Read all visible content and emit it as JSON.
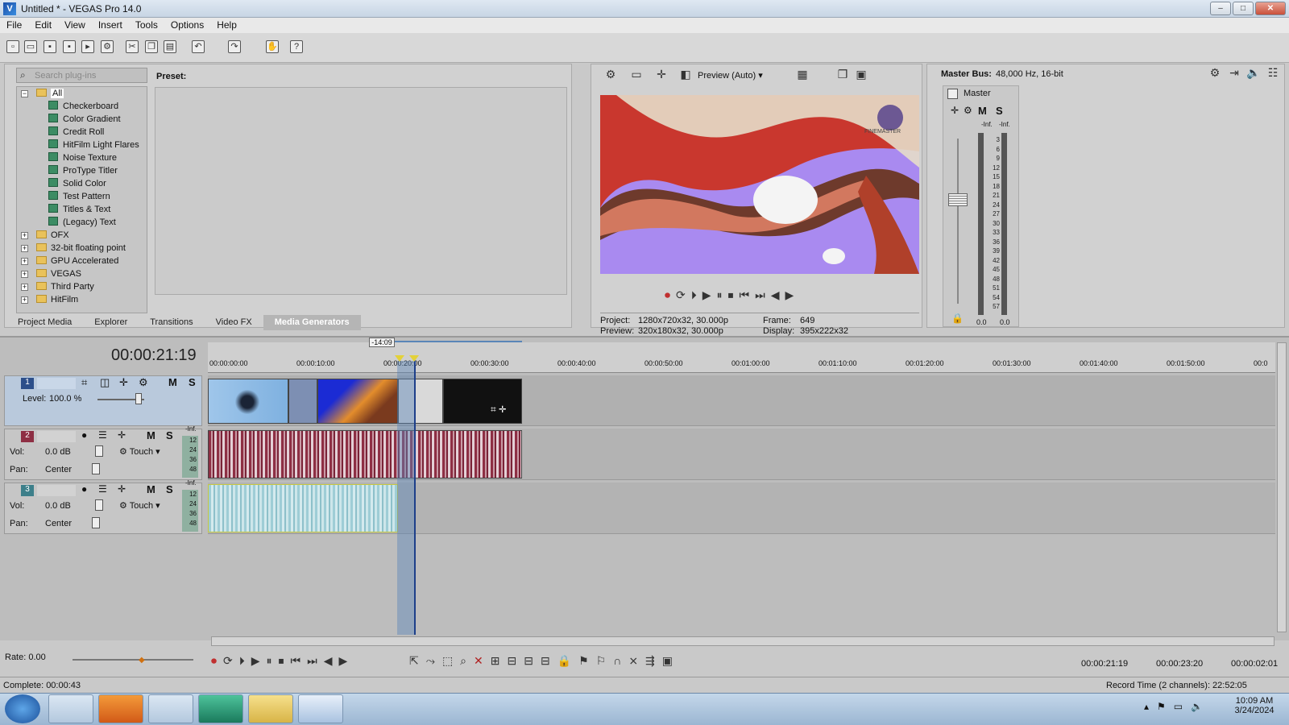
{
  "window": {
    "title": "Untitled * - VEGAS Pro 14.0",
    "min": "–",
    "max": "□",
    "close": "✕"
  },
  "menu": [
    "File",
    "Edit",
    "View",
    "Insert",
    "Tools",
    "Options",
    "Help"
  ],
  "media_gen": {
    "search_placeholder": "Search plug-ins",
    "preset_label": "Preset:",
    "tree_root": "All",
    "generators": [
      "Checkerboard",
      "Color Gradient",
      "Credit Roll",
      "HitFilm Light Flares",
      "Noise Texture",
      "ProType Titler",
      "Solid Color",
      "Test Pattern",
      "Titles & Text",
      "(Legacy) Text"
    ],
    "folders": [
      "OFX",
      "32-bit floating point",
      "GPU Accelerated",
      "VEGAS",
      "Third Party",
      "HitFilm"
    ],
    "tabs": [
      "Project Media",
      "Explorer",
      "Transitions",
      "Video FX",
      "Media Generators"
    ],
    "active_tab": "Media Generators"
  },
  "preview": {
    "mode": "Preview (Auto)",
    "project_label": "Project:",
    "project_value": "1280x720x32, 30.000p",
    "preview_label": "Preview:",
    "preview_value": "320x180x32, 30.000p",
    "frame_label": "Frame:",
    "frame_value": "649",
    "display_label": "Display:",
    "display_value": "395x222x32",
    "watermark": "FINEMASTER"
  },
  "master": {
    "title": "Master Bus:",
    "info": "48,000 Hz, 16-bit",
    "label": "Master",
    "m": "M",
    "s": "S",
    "inf_l": "-Inf.",
    "inf_r": "-Inf.",
    "scale": [
      "3",
      "6",
      "9",
      "12",
      "15",
      "18",
      "21",
      "24",
      "27",
      "30",
      "33",
      "36",
      "39",
      "42",
      "45",
      "48",
      "51",
      "54",
      "57"
    ],
    "val_l": "0.0",
    "val_r": "0.0"
  },
  "timeline": {
    "timecode": "00:00:21:19",
    "loop_marker": "-14:09",
    "ruler": [
      "00:00:00:00",
      "00:00:10:00",
      "00:00:20:00",
      "00:00:30:00",
      "00:00:40:00",
      "00:00:50:00",
      "00:01:00:00",
      "00:01:10:00",
      "00:01:20:00",
      "00:01:30:00",
      "00:01:40:00",
      "00:01:50:00",
      "00:0"
    ],
    "tracks": [
      {
        "num": "1",
        "level_label": "Level:",
        "level": "100.0 %",
        "m": "M",
        "s": "S"
      },
      {
        "num": "2",
        "vol_label": "Vol:",
        "vol": "0.0 dB",
        "mode": "Touch",
        "pan_label": "Pan:",
        "pan": "Center",
        "m": "M",
        "s": "S",
        "inf": "-Inf."
      },
      {
        "num": "3",
        "vol_label": "Vol:",
        "vol": "0.0 dB",
        "mode": "Touch",
        "pan_label": "Pan:",
        "pan": "Center",
        "m": "M",
        "s": "S",
        "inf": "-Inf."
      }
    ],
    "meter_ticks": [
      "12",
      "24",
      "36",
      "48"
    ]
  },
  "status": {
    "rate": "Rate: 0.00",
    "complete": "Complete: 00:00:43",
    "sel_start": "00:00:21:19",
    "sel_end": "00:00:23:20",
    "sel_len": "00:00:02:01",
    "record_time": "Record Time (2 channels): 22:52:05"
  },
  "taskbar": {
    "time": "10:09 AM",
    "date": "3/24/2024"
  },
  "colors": {
    "accent": "#5a86b8",
    "audio_wave": "#8e2f44",
    "audio_wave2": "#9ecdd6",
    "preview_purple": "#a98af0"
  }
}
